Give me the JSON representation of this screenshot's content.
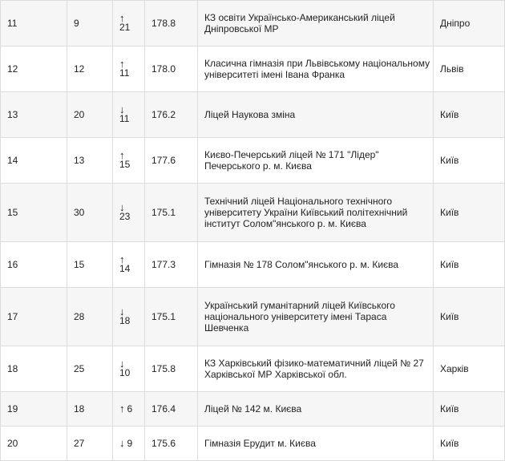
{
  "rows": [
    {
      "rank": "11",
      "prev": "9",
      "arrow": "↑",
      "change": "21",
      "layout": "stacked",
      "score": "178.8",
      "name": "КЗ освіти Українсько-Американський ліцей Дніпровської МР",
      "city": "Дніпро"
    },
    {
      "rank": "12",
      "prev": "12",
      "arrow": "↑",
      "change": "11",
      "layout": "stacked",
      "score": "178.0",
      "name": "Класична гімназія при Львівському національному університеті імені Івана Франка",
      "city": "Львів"
    },
    {
      "rank": "13",
      "prev": "20",
      "arrow": "↓",
      "change": "11",
      "layout": "stacked",
      "score": "176.2",
      "name": "Ліцей Наукова зміна",
      "city": "Київ"
    },
    {
      "rank": "14",
      "prev": "13",
      "arrow": "↑",
      "change": "15",
      "layout": "stacked",
      "score": "177.6",
      "name": "Києво-Печерський ліцей № 171 \"Лідер\" Печерського р. м. Києва",
      "city": "Київ"
    },
    {
      "rank": "15",
      "prev": "30",
      "arrow": "↓",
      "change": "23",
      "layout": "stacked",
      "score": "175.1",
      "name": "Технічний ліцей Національного технічного університету України Київський політехнічний інститут Солом\"янського р. м. Києва",
      "city": "Київ"
    },
    {
      "rank": "16",
      "prev": "15",
      "arrow": "↑",
      "change": "14",
      "layout": "stacked",
      "score": "177.3",
      "name": "Гімназія № 178 Солом\"янського р. м. Києва",
      "city": "Київ"
    },
    {
      "rank": "17",
      "prev": "28",
      "arrow": "↓",
      "change": "18",
      "layout": "stacked",
      "score": "175.1",
      "name": "Український гуманітарний ліцей Київського національного університету імені Тараса Шевченка",
      "city": "Київ"
    },
    {
      "rank": "18",
      "prev": "25",
      "arrow": "↓",
      "change": "10",
      "layout": "stacked",
      "score": "175.8",
      "name": "КЗ Харківський фізико-математичний ліцей № 27 Харківської МР Харківської обл.",
      "city": "Харків"
    },
    {
      "rank": "19",
      "prev": "18",
      "arrow": "↑",
      "change": "6",
      "layout": "inline",
      "score": "176.4",
      "name": "Ліцей № 142 м. Києва",
      "city": "Київ"
    },
    {
      "rank": "20",
      "prev": "27",
      "arrow": "↓",
      "change": "9",
      "layout": "inline",
      "score": "175.6",
      "name": "Гімназія Ерудит м. Києва",
      "city": "Київ"
    }
  ]
}
